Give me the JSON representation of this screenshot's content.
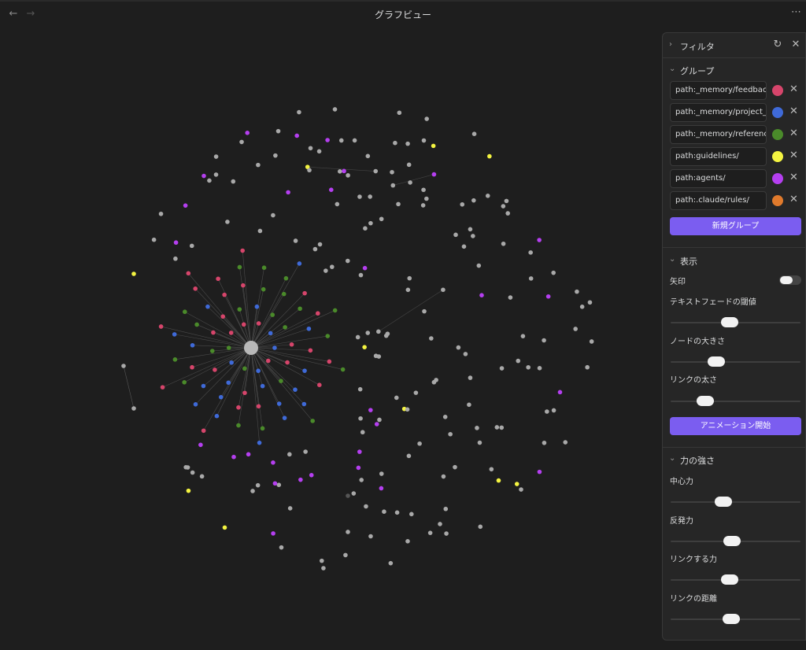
{
  "window": {
    "title": "グラフビュー",
    "back_icon": "←",
    "forward_icon": "→",
    "more_icon": "⋯"
  },
  "panel": {
    "filter": {
      "label": "フィルタ",
      "reset_icon": "↻",
      "close_icon": "✕"
    },
    "groups": {
      "label": "グループ",
      "remove_icon": "✕",
      "items": [
        {
          "query": "path:_memory/feedbac",
          "color": "#d6456b"
        },
        {
          "query": "path:_memory/project_",
          "color": "#3f6ad8"
        },
        {
          "query": "path:_memory/referenc",
          "color": "#4a8a2a"
        },
        {
          "query": "path:guidelines/",
          "color": "#f4f441"
        },
        {
          "query": "path:agents/",
          "color": "#b53ff0"
        },
        {
          "query": "path:.claude/rules/",
          "color": "#e07a2c"
        }
      ],
      "new_group_label": "新規グループ"
    },
    "display": {
      "label": "表示",
      "arrows_label": "矢印",
      "arrows_on": false,
      "text_fade_label": "テキストフェードの閾値",
      "text_fade_value": 0.45,
      "node_size_label": "ノードの大きさ",
      "node_size_value": 0.33,
      "link_thickness_label": "リンクの太さ",
      "link_thickness_value": 0.23,
      "animate_label": "アニメーション開始"
    },
    "forces": {
      "label": "力の強さ",
      "center_label": "中心力",
      "center_value": 0.39,
      "repel_label": "反発力",
      "repel_value": 0.47,
      "link_force_label": "リンクする力",
      "link_force_value": 0.45,
      "link_distance_label": "リンクの距離",
      "link_distance_value": 0.46
    }
  }
}
